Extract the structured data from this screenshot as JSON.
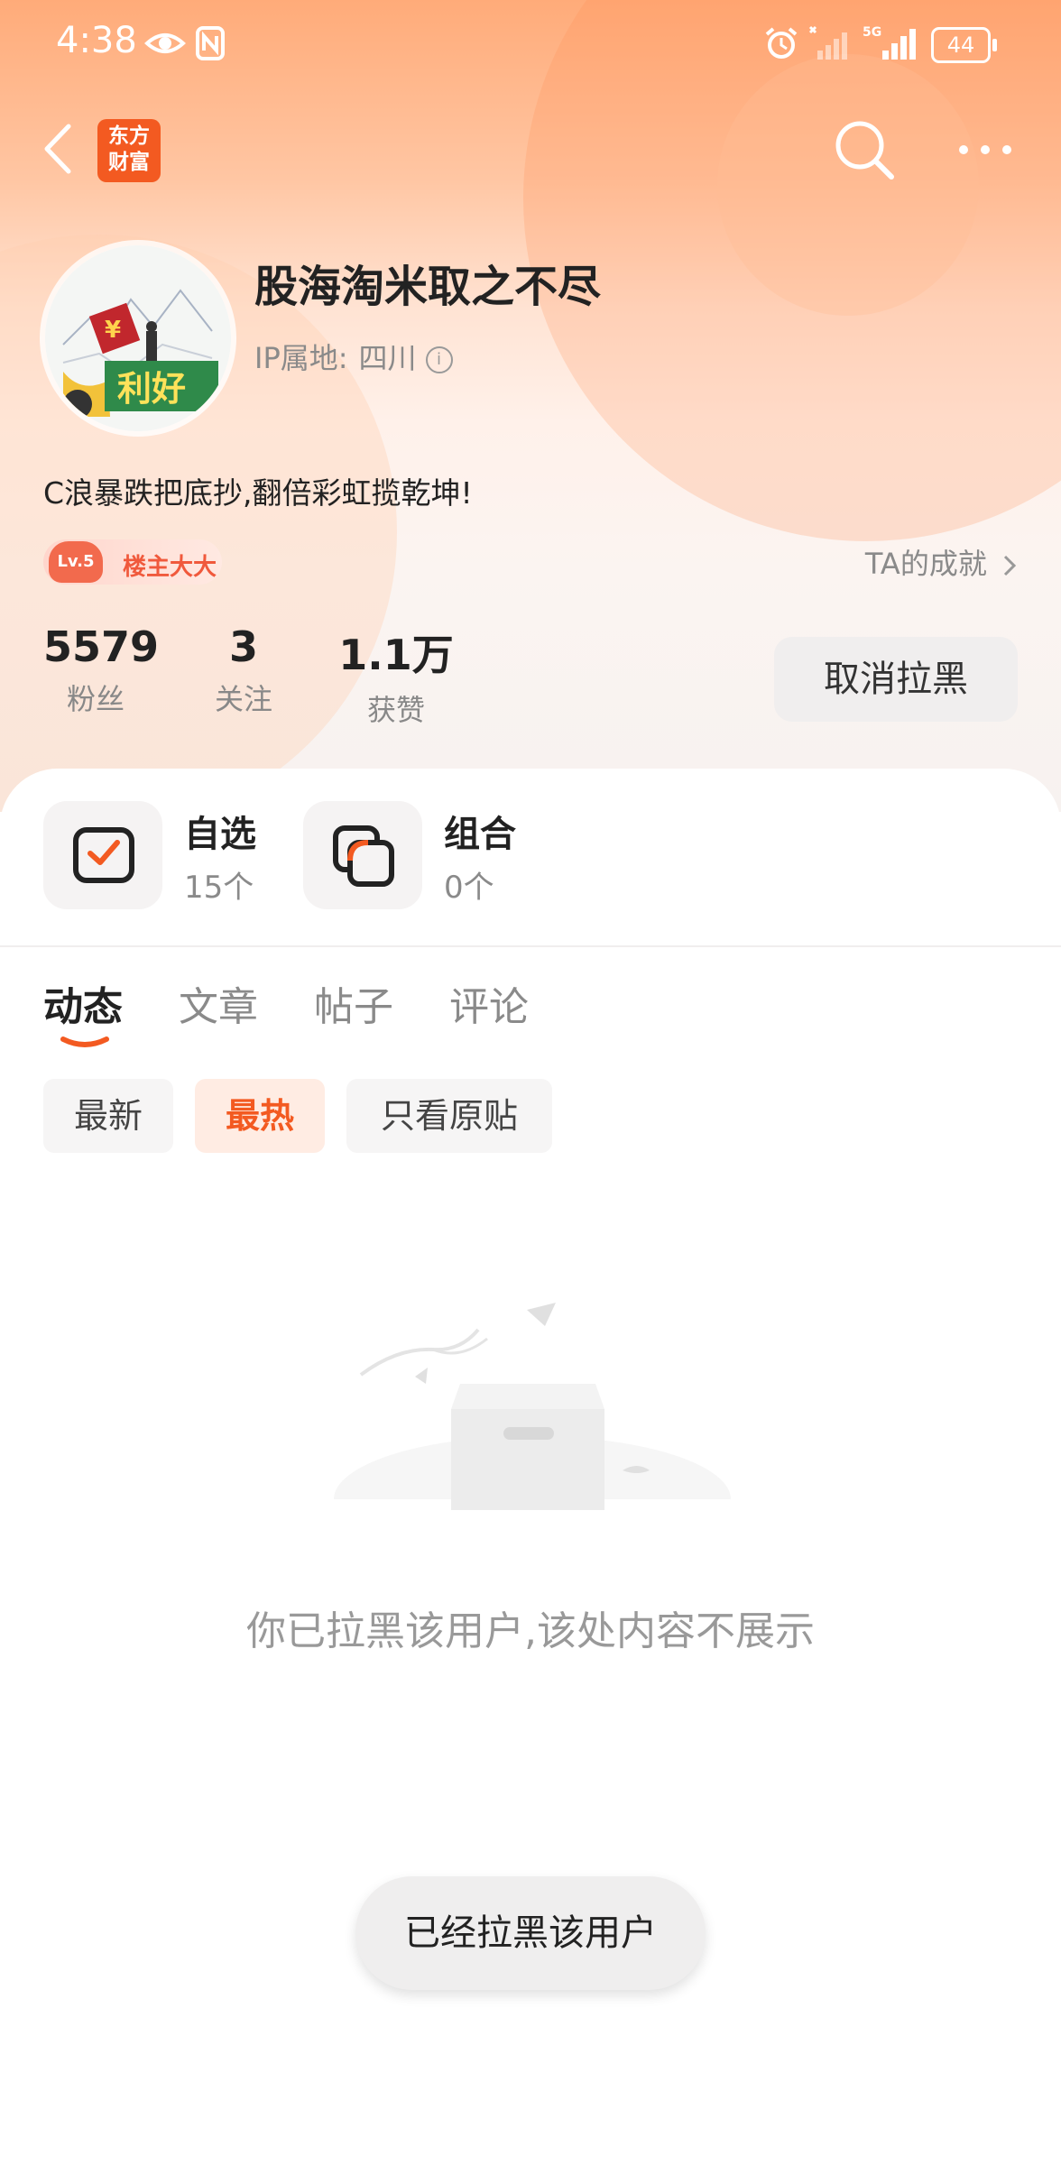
{
  "status_bar": {
    "time": "4:38",
    "battery": "44"
  },
  "nav": {
    "logo_line1": "东方",
    "logo_line2": "财富"
  },
  "profile": {
    "name": "股海淘米取之不尽",
    "ip_label": "IP属地:",
    "ip_value": "四川",
    "bio": "C浪暴跌把底抄,翻倍彩虹揽乾坤!",
    "level": "Lv.5",
    "level_title": "楼主大大",
    "achievement_link": "TA的成就",
    "avatar_text": "利好"
  },
  "stats": [
    {
      "value": "5579",
      "label": "粉丝"
    },
    {
      "value": "3",
      "label": "关注"
    },
    {
      "value": "1.1万",
      "label": "获赞"
    }
  ],
  "unblock_button": "取消拉黑",
  "quick_links": [
    {
      "title": "自选",
      "count": "15个"
    },
    {
      "title": "组合",
      "count": "0个"
    }
  ],
  "tabs": [
    "动态",
    "文章",
    "帖子",
    "评论"
  ],
  "filters": [
    "最新",
    "最热",
    "只看原贴"
  ],
  "empty_message": "你已拉黑该用户,该处内容不展示",
  "toast": "已经拉黑该用户",
  "colors": {
    "accent": "#f35a21",
    "accent_light": "#ffece3"
  }
}
